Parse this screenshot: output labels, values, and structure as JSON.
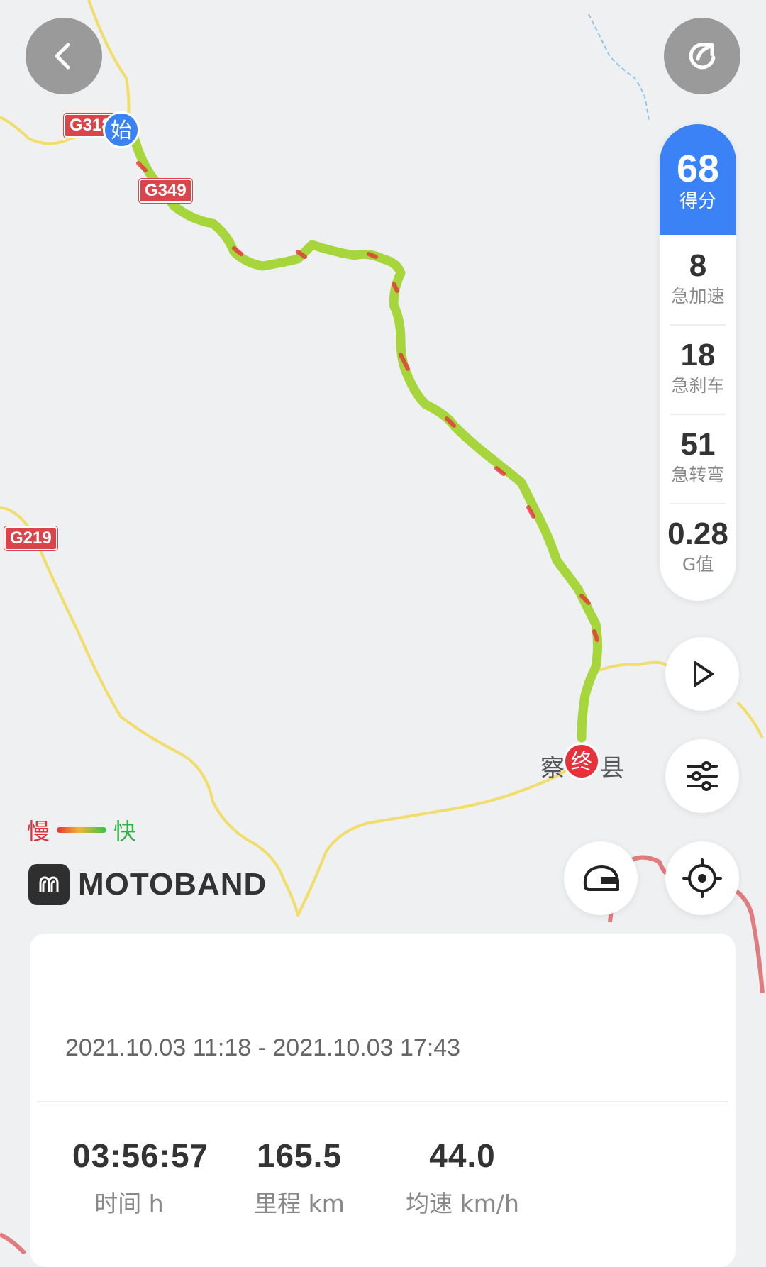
{
  "map": {
    "road_shields": [
      "G318",
      "G349",
      "G219"
    ],
    "start_marker": "始",
    "end_marker": "终",
    "end_place_left": "察",
    "end_place_right": "县"
  },
  "controls": {
    "back_icon": "chevron-left-icon",
    "share_icon": "share-icon",
    "play_icon": "play-icon",
    "filter_icon": "sliders-icon",
    "helmet_icon": "helmet-icon",
    "locate_icon": "crosshair-icon"
  },
  "score_panel": {
    "score": "68",
    "score_label": "得分",
    "stats": [
      {
        "value": "8",
        "label": "急加速"
      },
      {
        "value": "18",
        "label": "急刹车"
      },
      {
        "value": "51",
        "label": "急转弯"
      },
      {
        "value": "0.28",
        "label": "G值"
      }
    ]
  },
  "legend": {
    "slow": "慢",
    "fast": "快"
  },
  "brand": {
    "name": "MOTOBAND"
  },
  "trip": {
    "time_range": "2021.10.03 11:18 - 2021.10.03 17:43",
    "metrics": [
      {
        "value": "03:56:57",
        "label": "时间 h"
      },
      {
        "value": "165.5",
        "label": "里程 km"
      },
      {
        "value": "44.0",
        "label": "均速 km/h"
      }
    ]
  },
  "colors": {
    "accent": "#3b82f6",
    "road": "#f0dd6a",
    "national_road": "#e07b7e",
    "route_fast": "#7ac943",
    "route_slow": "#e8313b",
    "end_marker": "#e8313b",
    "start_marker": "#3b82f6"
  }
}
